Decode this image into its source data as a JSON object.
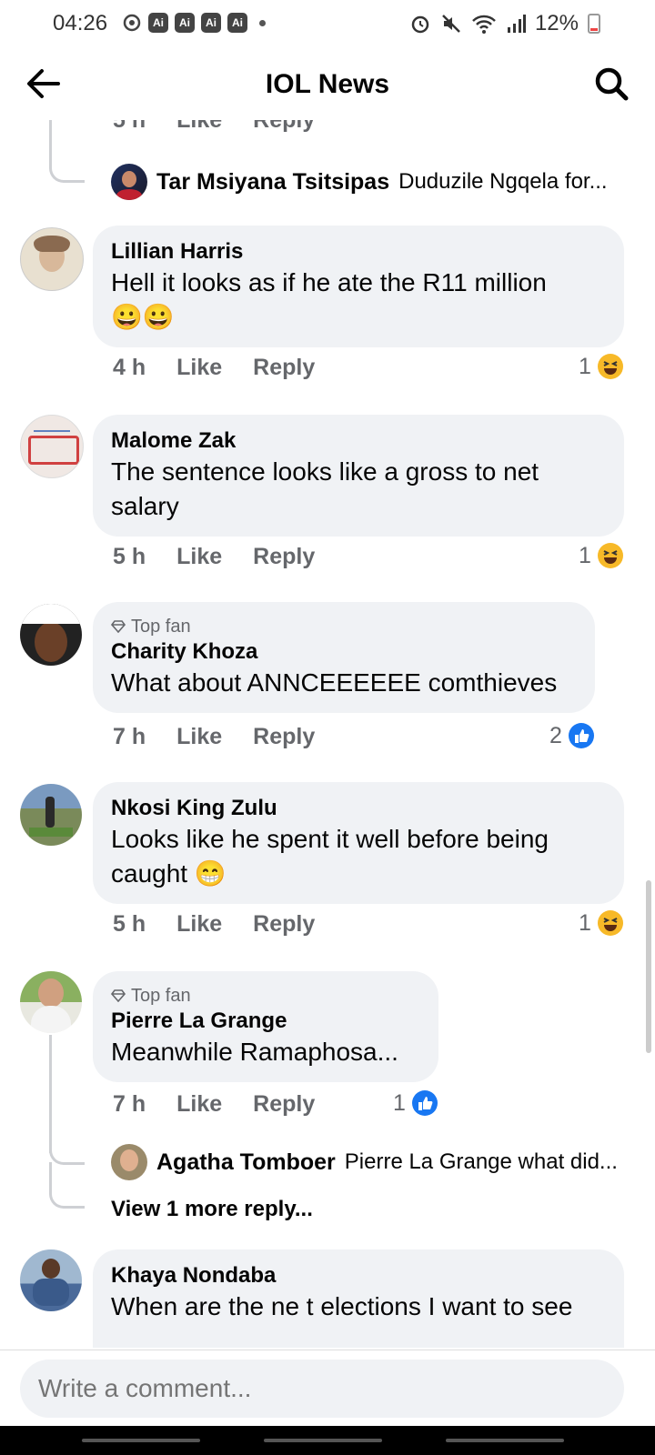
{
  "status": {
    "time": "04:26",
    "ai_badges": [
      "Ai",
      "Ai",
      "Ai",
      "Ai"
    ],
    "battery": "12%"
  },
  "header": {
    "title": "IOL News"
  },
  "top_partial": {
    "meta_labels": [
      "Like",
      "Reply"
    ],
    "reply_author": "Tar Msiyana Tsitsipas",
    "reply_text": "Duduzile Ngqela for..."
  },
  "comments": [
    {
      "author": "Lillian Harris",
      "text": "Hell it looks as if he ate the R11 million",
      "emoji": "😀😀",
      "time": "4 h",
      "like": "Like",
      "reply": "Reply",
      "reaction_count": "1",
      "reaction": "haha"
    },
    {
      "author": "Malome Zak",
      "text": "The sentence looks like a gross to net salary",
      "time": "5 h",
      "like": "Like",
      "reply": "Reply",
      "reaction_count": "1",
      "reaction": "haha"
    },
    {
      "badge": "Top fan",
      "author": "Charity Khoza",
      "text": "What about ANNCEEEEEE comthieves",
      "time": "7 h",
      "like": "Like",
      "reply": "Reply",
      "reaction_count": "2",
      "reaction": "like"
    },
    {
      "author": "Nkosi King Zulu",
      "text": "Looks like he spent it well before being caught",
      "emoji": "😁",
      "time": "5 h",
      "like": "Like",
      "reply": "Reply",
      "reaction_count": "1",
      "reaction": "haha"
    },
    {
      "badge": "Top fan",
      "author": "Pierre La Grange",
      "text": "Meanwhile Ramaphosa...",
      "time": "7 h",
      "like": "Like",
      "reply": "Reply",
      "reaction_count": "1",
      "reaction": "like",
      "reply_author": "Agatha Tomboer",
      "reply_text": "Pierre La Grange what did...",
      "view_more": "View 1 more reply..."
    },
    {
      "author": "Khaya Nondaba",
      "text": "When are the ne t elections I want to see"
    }
  ],
  "composer": {
    "placeholder": "Write a comment..."
  },
  "colors": {
    "bubble": "#f0f2f5",
    "like_blue": "#1877f2",
    "haha_yellow": "#f7b928",
    "meta_gray": "#65676b"
  }
}
